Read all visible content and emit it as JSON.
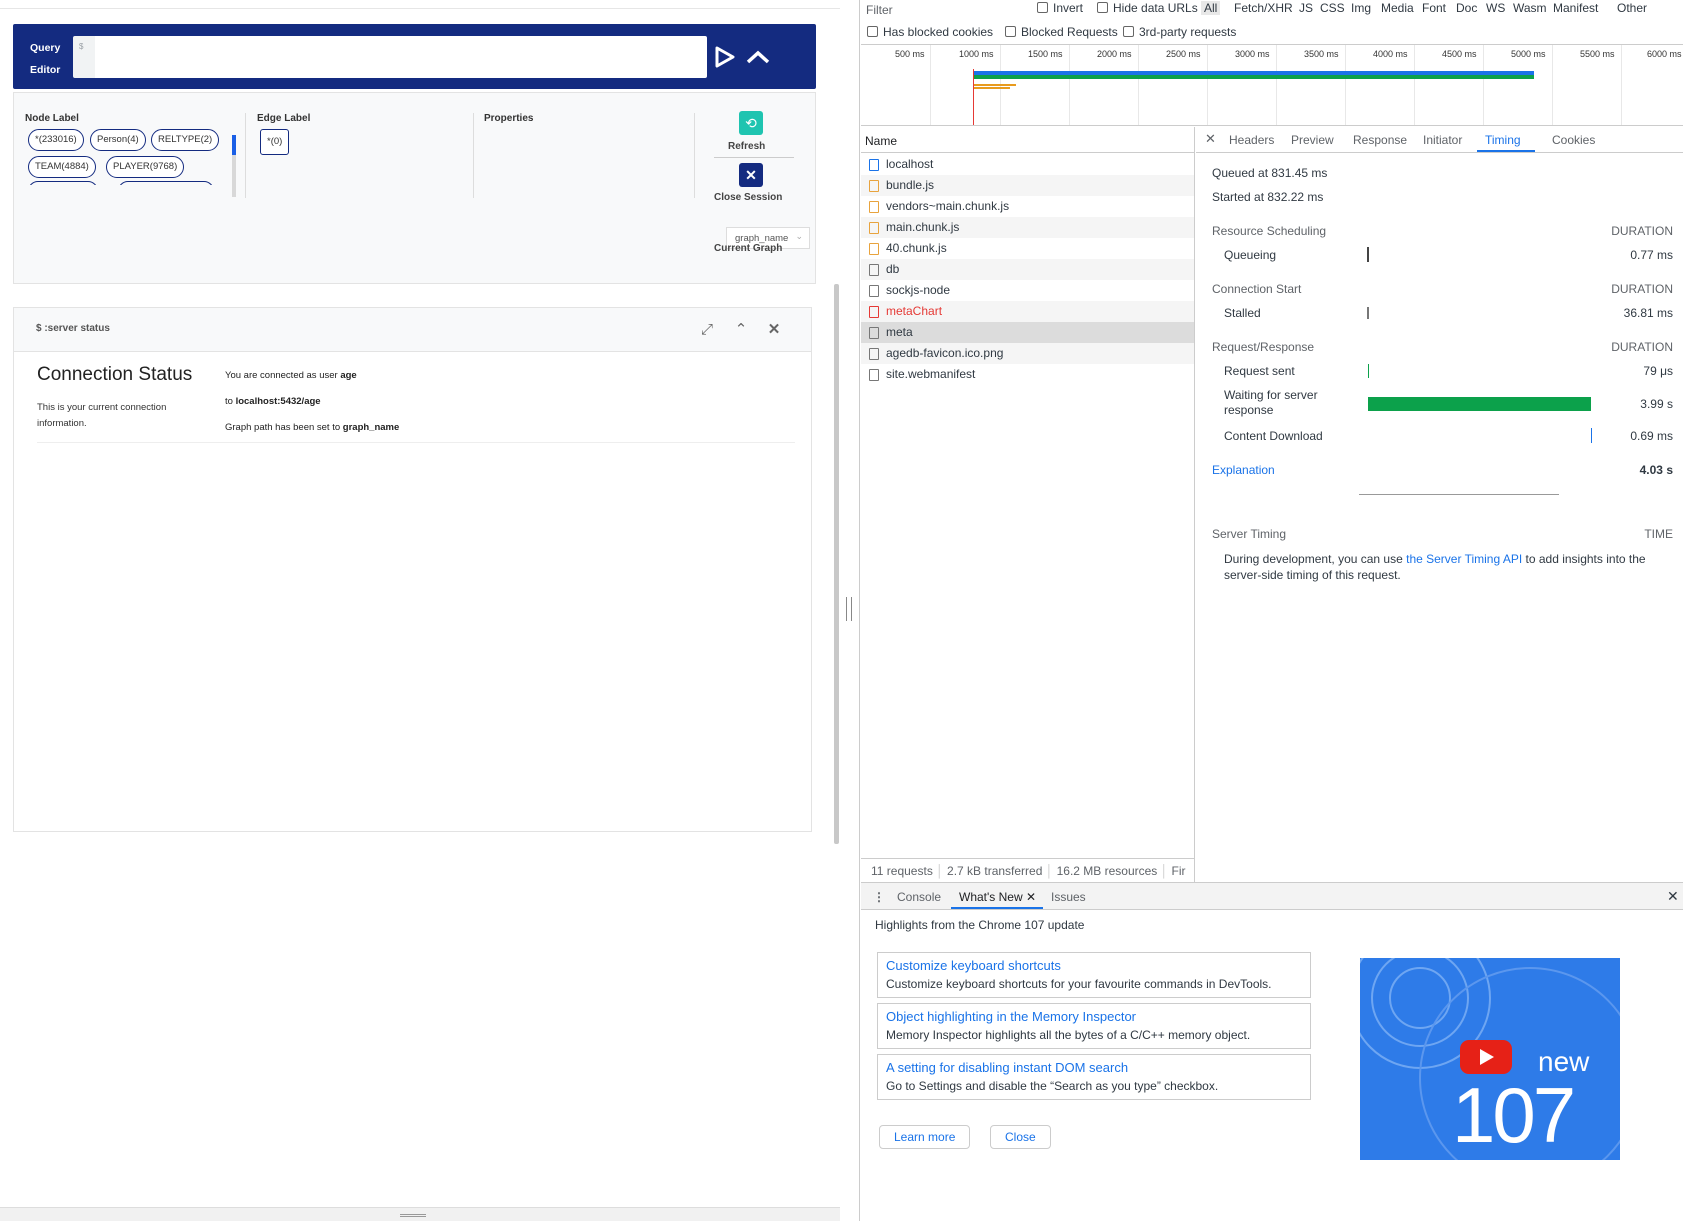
{
  "app": {
    "query_editor": {
      "label_line1": "Query",
      "label_line2": "Editor",
      "prompt": "$"
    },
    "metadata": {
      "node_label_title": "Node Label",
      "node_labels": [
        "*(233016)",
        "Person(4)",
        "RELTYPE(2)",
        "TEAM(4884)",
        "PLAYER(9768)"
      ],
      "edge_label_title": "Edge Label",
      "edge_labels": [
        "*(0)"
      ],
      "properties_title": "Properties",
      "refresh_label": "Refresh",
      "close_session_label": "Close Session",
      "graph_select_value": "graph_name",
      "current_graph_label": "Current Graph"
    },
    "frame": {
      "title": "$ :server status",
      "heading": "Connection Status",
      "description": "This is your current connection information.",
      "line1_prefix": "You are connected as user ",
      "line1_user": "age",
      "line2_prefix": "to ",
      "line2_host": "localhost:5432/age",
      "line3_prefix": "Graph path has been set to ",
      "line3_graph": "graph_name"
    }
  },
  "devtools": {
    "filter": {
      "placeholder": "Filter",
      "invert": "Invert",
      "hide_data_urls": "Hide data URLs",
      "types": [
        "All",
        "Fetch/XHR",
        "JS",
        "CSS",
        "Img",
        "Media",
        "Font",
        "Doc",
        "WS",
        "Wasm",
        "Manifest",
        "Other"
      ],
      "has_blocked_cookies": "Has blocked cookies",
      "blocked_requests": "Blocked Requests",
      "third_party": "3rd-party requests"
    },
    "overview_ticks": [
      "500 ms",
      "1000 ms",
      "1500 ms",
      "2000 ms",
      "2500 ms",
      "3000 ms",
      "3500 ms",
      "4000 ms",
      "4500 ms",
      "5000 ms",
      "5500 ms",
      "6000 ms"
    ],
    "list": {
      "name_header": "Name",
      "requests": [
        {
          "name": "localhost",
          "type": "doc"
        },
        {
          "name": "bundle.js",
          "type": "script"
        },
        {
          "name": "vendors~main.chunk.js",
          "type": "script"
        },
        {
          "name": "main.chunk.js",
          "type": "script"
        },
        {
          "name": "40.chunk.js",
          "type": "script"
        },
        {
          "name": "db",
          "type": "other"
        },
        {
          "name": "sockjs-node",
          "type": "other"
        },
        {
          "name": "metaChart",
          "type": "error"
        },
        {
          "name": "meta",
          "type": "selected"
        },
        {
          "name": "agedb-favicon.ico.png",
          "type": "other"
        },
        {
          "name": "site.webmanifest",
          "type": "other"
        }
      ],
      "status": [
        "11 requests",
        "2.7 kB transferred",
        "16.2 MB resources",
        "Fir"
      ]
    },
    "detail": {
      "tabs": [
        "Headers",
        "Preview",
        "Response",
        "Initiator",
        "Timing",
        "Cookies"
      ],
      "active_tab": "Timing",
      "queued": "Queued at 831.45 ms",
      "started": "Started at 832.22 ms",
      "duration_header": "DURATION",
      "sections": [
        {
          "title": "Resource Scheduling",
          "rows": [
            {
              "label": "Queueing",
              "value": "0.77 ms"
            }
          ]
        },
        {
          "title": "Connection Start",
          "rows": [
            {
              "label": "Stalled",
              "value": "36.81 ms"
            }
          ]
        },
        {
          "title": "Request/Response",
          "rows": [
            {
              "label": "Request sent",
              "value": "79 μs"
            },
            {
              "label": "Waiting for server response",
              "value": "3.99 s"
            },
            {
              "label": "Content Download",
              "value": "0.69 ms"
            }
          ]
        }
      ],
      "explanation": "Explanation",
      "total": "4.03 s",
      "server_timing_title": "Server Timing",
      "server_timing_time": "TIME",
      "server_timing_text_pre": "During development, you can use ",
      "server_timing_link": "the Server Timing API",
      "server_timing_text_post": " to add insights into the server-side timing of this request."
    },
    "drawer": {
      "tabs": [
        "Console",
        "What's New",
        "Issues"
      ],
      "active_tab": "What's New",
      "highlights": "Highlights from the Chrome 107 update",
      "cards": [
        {
          "title": "Customize keyboard shortcuts",
          "desc": "Customize keyboard shortcuts for your favourite commands in DevTools."
        },
        {
          "title": "Object highlighting in the Memory Inspector",
          "desc": "Memory Inspector highlights all the bytes of a C/C++ memory object."
        },
        {
          "title": "A setting for disabling instant DOM search",
          "desc": "Go to Settings and disable the “Search as you type” checkbox."
        }
      ],
      "learn_more": "Learn more",
      "close": "Close",
      "promo_new": "new",
      "promo_version": "107"
    }
  }
}
